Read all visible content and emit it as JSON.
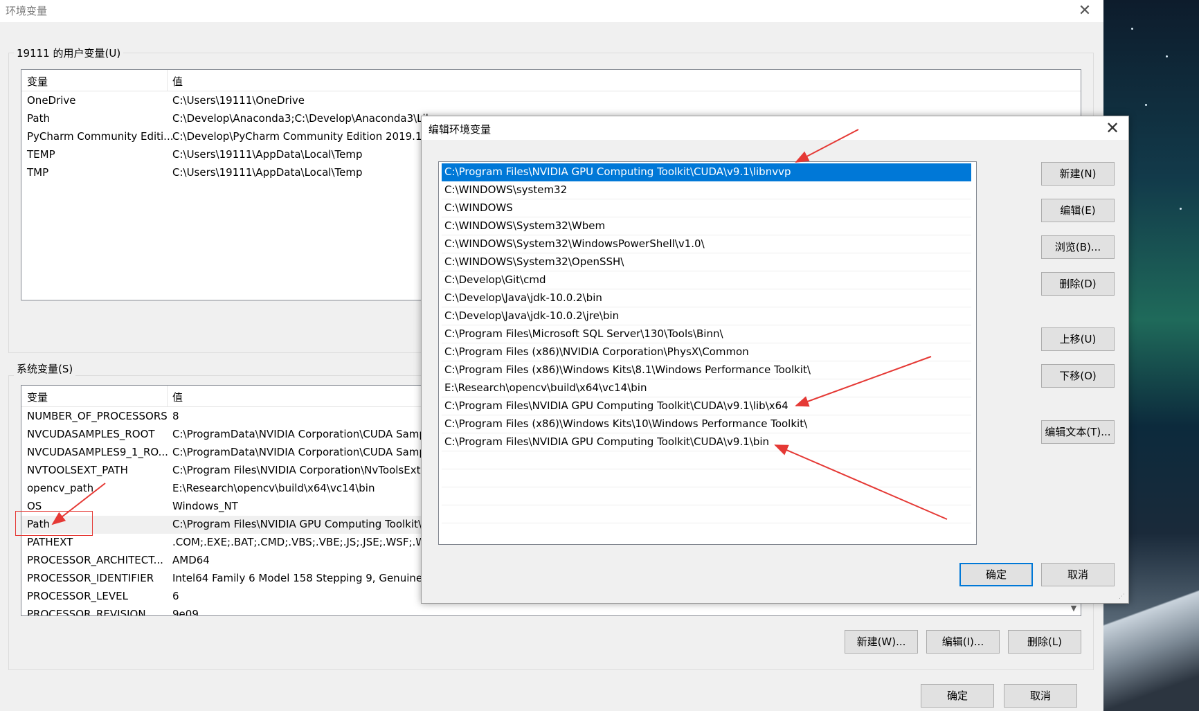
{
  "window": {
    "title": "环境变量",
    "close_icon": "close-icon"
  },
  "user_vars": {
    "group_label": "19111 的用户变量(U)",
    "col_var": "变量",
    "col_val": "值",
    "rows": [
      {
        "name": "OneDrive",
        "value": "C:\\Users\\19111\\OneDrive"
      },
      {
        "name": "Path",
        "value": "C:\\Develop\\Anaconda3;C:\\Develop\\Anaconda3\\Lib"
      },
      {
        "name": "PyCharm Community Editi...",
        "value": "C:\\Develop\\PyCharm Community Edition 2019.1.1\\"
      },
      {
        "name": "TEMP",
        "value": "C:\\Users\\19111\\AppData\\Local\\Temp"
      },
      {
        "name": "TMP",
        "value": "C:\\Users\\19111\\AppData\\Local\\Temp"
      }
    ]
  },
  "system_vars": {
    "group_label": "系统变量(S)",
    "col_var": "变量",
    "col_val": "值",
    "rows": [
      {
        "name": "NUMBER_OF_PROCESSORS",
        "value": "8"
      },
      {
        "name": "NVCUDASAMPLES_ROOT",
        "value": "C:\\ProgramData\\NVIDIA Corporation\\CUDA Samp"
      },
      {
        "name": "NVCUDASAMPLES9_1_RO...",
        "value": "C:\\ProgramData\\NVIDIA Corporation\\CUDA Samp"
      },
      {
        "name": "NVTOOLSEXT_PATH",
        "value": "C:\\Program Files\\NVIDIA Corporation\\NvToolsExt"
      },
      {
        "name": "opencv_path",
        "value": "E:\\Research\\opencv\\build\\x64\\vc14\\bin"
      },
      {
        "name": "OS",
        "value": "Windows_NT"
      },
      {
        "name": "Path",
        "value": "C:\\Program Files\\NVIDIA GPU Computing Toolkit\\"
      },
      {
        "name": "PATHEXT",
        "value": ".COM;.EXE;.BAT;.CMD;.VBS;.VBE;.JS;.JSE;.WSF;.WSH"
      },
      {
        "name": "PROCESSOR_ARCHITECT...",
        "value": "AMD64"
      },
      {
        "name": "PROCESSOR_IDENTIFIER",
        "value": "Intel64 Family 6 Model 158 Stepping 9, GenuineIn"
      },
      {
        "name": "PROCESSOR_LEVEL",
        "value": "6"
      },
      {
        "name": "PROCESSOR_REVISION",
        "value": "9e09"
      }
    ],
    "buttons": {
      "new": "新建(W)...",
      "edit": "编辑(I)...",
      "delete": "删除(L)"
    }
  },
  "main_buttons": {
    "ok": "确定",
    "cancel": "取消"
  },
  "edit_dialog": {
    "title": "编辑环境变量",
    "paths": [
      "C:\\Program Files\\NVIDIA GPU Computing Toolkit\\CUDA\\v9.1\\libnvvp",
      "C:\\WINDOWS\\system32",
      "C:\\WINDOWS",
      "C:\\WINDOWS\\System32\\Wbem",
      "C:\\WINDOWS\\System32\\WindowsPowerShell\\v1.0\\",
      "C:\\WINDOWS\\System32\\OpenSSH\\",
      "C:\\Develop\\Git\\cmd",
      "C:\\Develop\\Java\\jdk-10.0.2\\bin",
      "C:\\Develop\\Java\\jdk-10.0.2\\jre\\bin",
      "C:\\Program Files\\Microsoft SQL Server\\130\\Tools\\Binn\\",
      "C:\\Program Files (x86)\\NVIDIA Corporation\\PhysX\\Common",
      "C:\\Program Files (x86)\\Windows Kits\\8.1\\Windows Performance Toolkit\\",
      "E:\\Research\\opencv\\build\\x64\\vc14\\bin",
      "C:\\Program Files\\NVIDIA GPU Computing Toolkit\\CUDA\\v9.1\\lib\\x64",
      "C:\\Program Files (x86)\\Windows Kits\\10\\Windows Performance Toolkit\\",
      "C:\\Program Files\\NVIDIA GPU Computing Toolkit\\CUDA\\v9.1\\bin"
    ],
    "buttons": {
      "new": "新建(N)",
      "edit": "编辑(E)",
      "browse": "浏览(B)...",
      "delete": "删除(D)",
      "move_up": "上移(U)",
      "move_down": "下移(O)",
      "edit_text": "编辑文本(T)...",
      "ok": "确定",
      "cancel": "取消"
    }
  },
  "colors": {
    "selection": "#0078d7",
    "annotation": "#e53935"
  }
}
